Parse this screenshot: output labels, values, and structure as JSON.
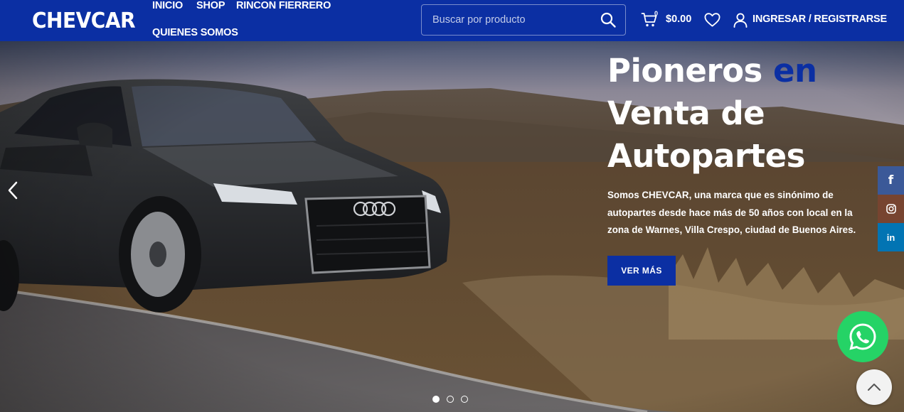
{
  "brand": {
    "logo": "CHEVCAR"
  },
  "nav": {
    "items": [
      {
        "label": "INICIO"
      },
      {
        "label": "SHOP"
      },
      {
        "label": "RINCON FIERRERO"
      },
      {
        "label": "QUIENES SOMOS"
      }
    ]
  },
  "search": {
    "placeholder": "Buscar por producto",
    "value": ""
  },
  "cart": {
    "count": "0",
    "total": "$0.00"
  },
  "account": {
    "login_label": "INGRESAR / REGISTRARSE"
  },
  "hero": {
    "title_word_1": "Pioneros",
    "title_accent": "en",
    "title_line_2": "Venta de",
    "title_line_3": "Autopartes",
    "description": "Somos CHEVCAR, una marca que es sinónimo de autopartes desde hace más de 50 años con local en la zona de Warnes, Villa Crespo, ciudad de Buenos Aires.",
    "cta_label": "VER MÁS",
    "active_slide": 1,
    "slide_count": 3
  },
  "social": [
    {
      "name": "facebook",
      "glyph": "f",
      "color": "#3b5998"
    },
    {
      "name": "instagram",
      "glyph": "◎",
      "color": "#774430"
    },
    {
      "name": "linkedin",
      "glyph": "in",
      "color": "#0274b3"
    }
  ],
  "colors": {
    "primary": "#0b2fa3",
    "whatsapp": "#25d366"
  }
}
